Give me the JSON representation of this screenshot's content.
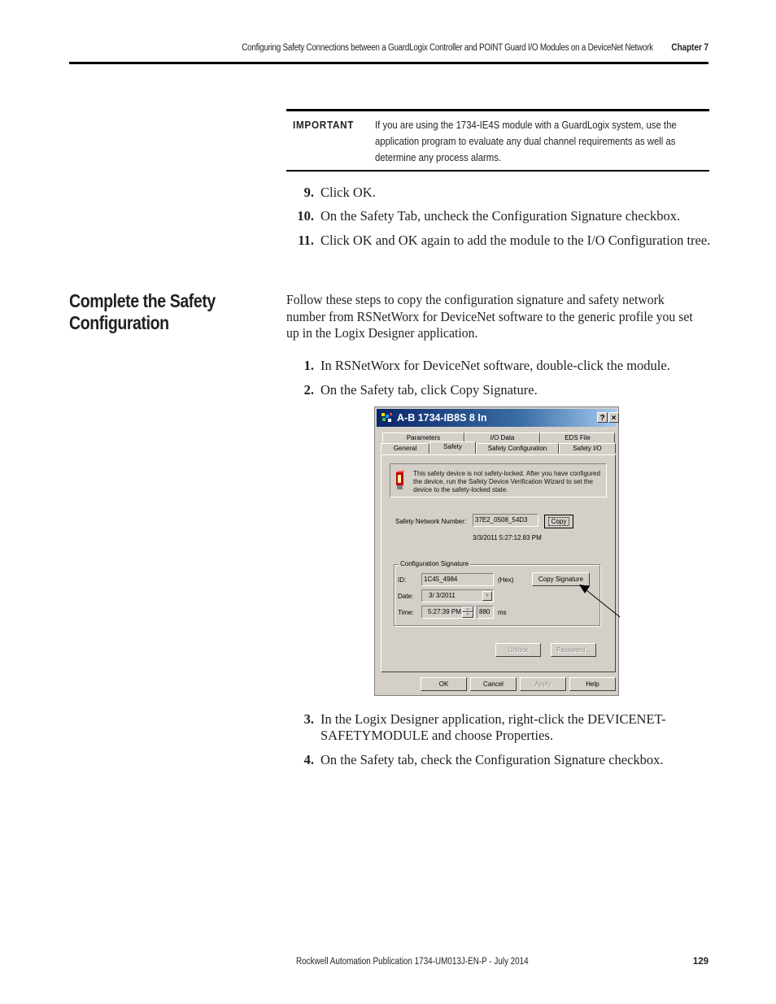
{
  "header": {
    "running_title": "Configuring Safety Connections between a GuardLogix Controller and POINT Guard I/O Modules on a DeviceNet Network",
    "chapter": "Chapter 7"
  },
  "important": {
    "label": "IMPORTANT",
    "text": "If you are using the 1734-IE4S module with a GuardLogix system, use the application program to evaluate any dual channel requirements as well as determine any process alarms."
  },
  "steps_before": [
    {
      "num": "9.",
      "text": "Click OK."
    },
    {
      "num": "10.",
      "text": "On the Safety Tab, uncheck the Configuration Signature checkbox."
    },
    {
      "num": "11.",
      "text": "Click OK and OK again to add the module to the I/O Configuration tree."
    }
  ],
  "section": {
    "title": "Complete the Safety Configuration",
    "intro": "Follow these steps to copy the configuration signature and safety network number from RSNetWorx for DeviceNet software to the generic profile you set up in the Logix Designer application."
  },
  "steps_section": [
    {
      "num": "1.",
      "text": "In RSNetWorx for DeviceNet software, double-click the module."
    },
    {
      "num": "2.",
      "text": "On the Safety tab, click Copy Signature."
    },
    {
      "num": "3.",
      "text": "In the Logix Designer application, right-click the DEVICENET-",
      "text2": "SAFETYMODULE and choose Properties."
    },
    {
      "num": "4.",
      "text": "On the Safety tab, check the Configuration Signature checkbox."
    }
  ],
  "dialog": {
    "title": "A-B 1734-IB8S 8 In",
    "help_button": "?",
    "close_button": "×",
    "tabs_back": [
      "Parameters",
      "I/O Data",
      "EDS File"
    ],
    "tabs_front": [
      "General",
      "Safety",
      "Safety Configuration",
      "Safety I/O"
    ],
    "active_tab": "Safety",
    "warning_text": "This safety device is not safety-locked. After you have configured the device, run the Safety Device Verification Wizard to set the device to the safety-locked state.",
    "snn_label": "Safety Network Number:",
    "snn_value": "37E2_0508_54D3",
    "copy_button": "Copy",
    "snn_timestamp": "3/3/2011  5:27:12.83 PM",
    "config_signature": {
      "group_title": "Configuration Signature",
      "id_label": "ID:",
      "id_value": "1C45_4984",
      "id_suffix": "(Hex)",
      "copy_signature_button": "Copy Signature",
      "date_label": "Date:",
      "date_value": "3/  3/2011",
      "time_label": "Time:",
      "time_value": "5:27:39 PM",
      "ms_value": "880",
      "ms_label": "ms"
    },
    "unlock_button": "Unlock",
    "password_button": "Password...",
    "footer_buttons": [
      "OK",
      "Cancel",
      "Apply",
      "Help"
    ]
  },
  "footer": {
    "publication": "Rockwell Automation Publication 1734-UM013J-EN-P - July 2014",
    "page": "129"
  }
}
